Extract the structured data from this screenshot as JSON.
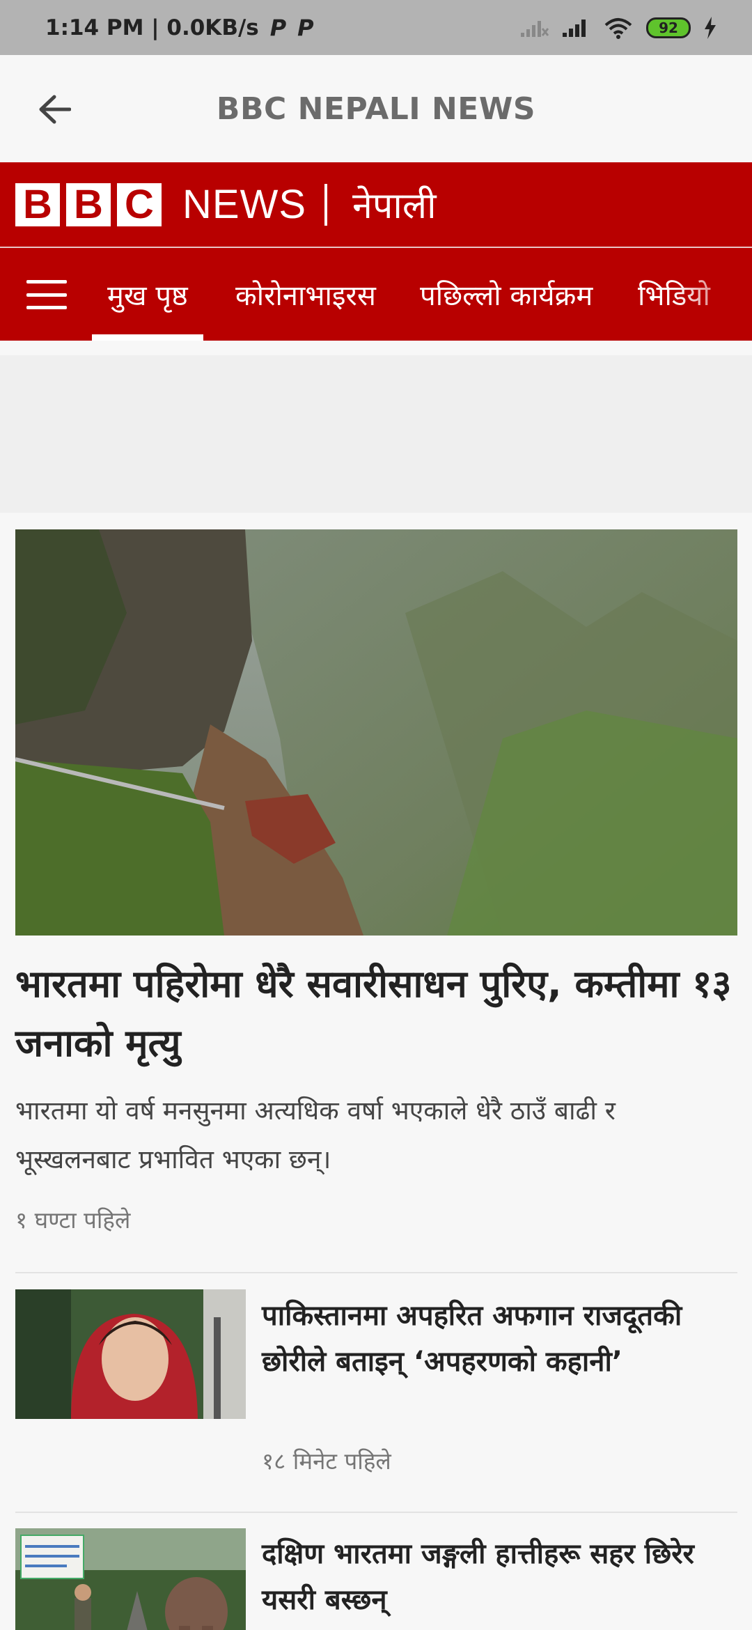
{
  "status_bar": {
    "time_speed": "1:14 PM | 0.0KB/s",
    "p_icon": "P",
    "battery": "92"
  },
  "app_bar": {
    "title": "BBC NEPALI NEWS"
  },
  "brand": {
    "letters": [
      "B",
      "B",
      "C"
    ],
    "news": "NEWS",
    "language": "नेपाली",
    "color": "#b80000"
  },
  "nav": {
    "tabs": [
      {
        "label": "मुख पृष्ठ",
        "active": true
      },
      {
        "label": "कोरोनाभाइरस",
        "active": false
      },
      {
        "label": "पछिल्लो कार्यक्रम",
        "active": false
      },
      {
        "label": "भिडियो",
        "active": false
      }
    ]
  },
  "hero": {
    "title": "भारतमा पहिरोमा धेरै सवारीसाधन पुरिए, कम्तीमा १३ जनाको मृत्यु",
    "summary": "भारतमा यो वर्ष मनसुनमा अत्यधिक वर्षा भएकाले धेरै ठाउँ बाढी र भूस्खलनबाट प्रभावित भएका छन्।",
    "time": "१ घण्टा पहिले"
  },
  "stories": [
    {
      "title": "पाकिस्तानमा अपहरित अफगान राजदूतकी छोरीले बताइन् ‘अपहरणको कहानी’",
      "time": "१८ मिनेट पहिले"
    },
    {
      "title": "दक्षिण भारतमा जङ्गली हात्तीहरू सहर छिरेर यसरी बस्छन्"
    }
  ]
}
